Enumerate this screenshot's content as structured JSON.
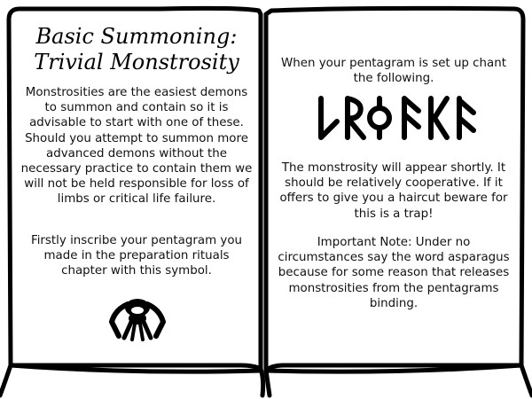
{
  "left_page": {
    "title_line1": "Basic Summoning:",
    "title_line2": "Trivial Monstrosity",
    "paragraph1": "Monstrosities are the easiest demons to summon and contain so it is advisable to start with one of these. Should you attempt to summon more advanced demons without the necessary practice to contain them we will not be held responsible for loss of limbs or critical life failure.",
    "paragraph2": "Firstly inscribe your pentagram you made in the preparation rituals chapter with this symbol.",
    "symbol_icon": "monstrosity-sigil-icon"
  },
  "right_page": {
    "intro": "When your pentagram is set up chant the following.",
    "chant_icon": "rune-chant-icon",
    "paragraph1": "The monstrosity will appear shortly. It should be relatively cooperative. If it offers to give you a haircut beware for this is a trap!",
    "paragraph2": "Important Note: Under no circumstances say the word asparagus because for some reason that releases monstrosities from the pentagrams binding."
  },
  "colors": {
    "ink": "#000000",
    "paper": "#ffffff"
  }
}
